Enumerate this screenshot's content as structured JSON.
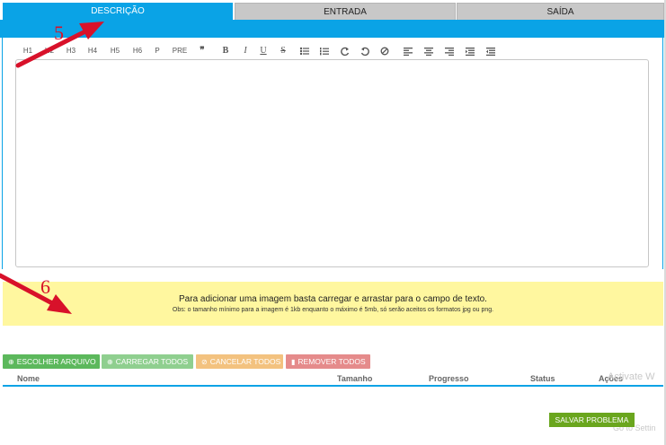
{
  "tabs": [
    {
      "label": "DESCRIÇÃO",
      "active": true
    },
    {
      "label": "ENTRADA",
      "active": false
    },
    {
      "label": "SAÍDA",
      "active": false
    }
  ],
  "toolbar": {
    "h1": "H1",
    "h2": "H2",
    "h3": "H3",
    "h4": "H4",
    "h5": "H5",
    "h6": "H6",
    "p": "P",
    "pre": "PRE",
    "quote": "❞",
    "bold": "B",
    "italic": "I",
    "underline": "U",
    "strike": "S"
  },
  "notice": {
    "main": "Para adicionar uma imagem basta carregar e arrastar para o campo de texto.",
    "sub": "Obs: o tamanho mínimo para a imagem é 1kb enquanto o máximo é 5mb, só serão aceitos os formatos jpg ou png."
  },
  "buttons": {
    "choose": "ESCOLHER ARQUIVO",
    "upload_all": "CARREGAR TODOS",
    "cancel_all": "CANCELAR TODOS",
    "remove_all": "REMOVER TODOS",
    "save": "SALVAR PROBLEMA"
  },
  "table": {
    "headers": [
      "Nome",
      "Tamanho",
      "Progresso",
      "Status",
      "Ações"
    ]
  },
  "annotations": {
    "five": "5",
    "six": "6"
  },
  "watermark": {
    "line1": "Activate W",
    "line2": "Go to Settin"
  },
  "colors": {
    "accent": "#0aa3e6",
    "annotation": "#d8112a",
    "notice_bg": "#fff79f",
    "save": "#6aa61e"
  }
}
